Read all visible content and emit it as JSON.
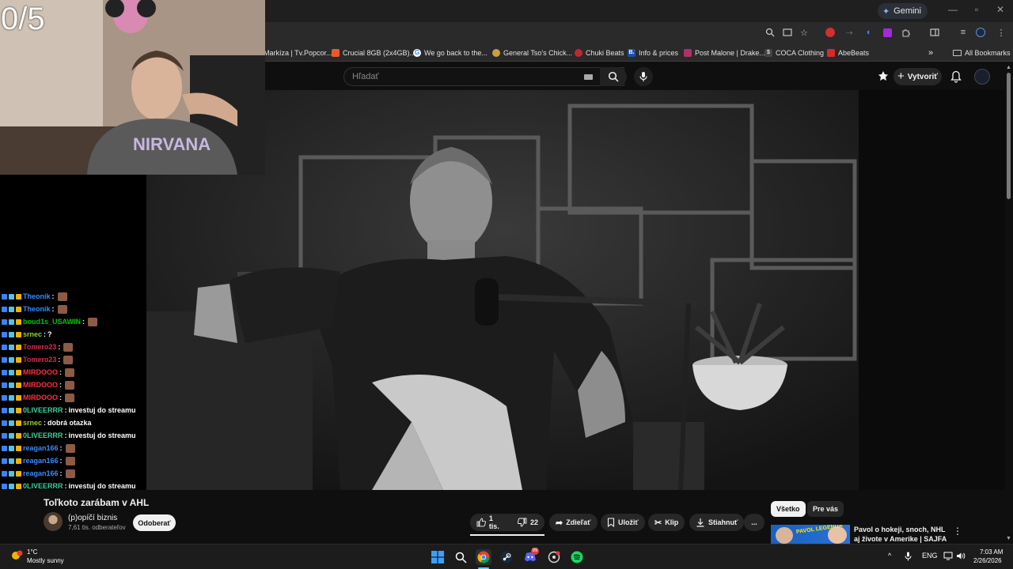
{
  "browser": {
    "gemini_label": "Gemini",
    "bookmarks": [
      {
        "label": "Markíza | Tv.Popcor...",
        "color": "#e8a000"
      },
      {
        "label": "Crucial 8GB (2x4GB)...",
        "color": "#e8592c"
      },
      {
        "label": "We go back to the...",
        "color": "#4285f4"
      },
      {
        "label": "General Tso's Chick...",
        "color": "#c8a040"
      },
      {
        "label": "Chuki Beats",
        "color": "#c4262e"
      },
      {
        "label": "Info & prices",
        "color": "#1f4fa8"
      },
      {
        "label": "Post Malone | Drake...",
        "color": "#b0306a"
      },
      {
        "label": "COCA Clothing",
        "color": "#444444"
      },
      {
        "label": "AbeBeats",
        "color": "#d62b2b"
      }
    ],
    "bookmarks_overflow": "»",
    "all_bookmarks": "All Bookmarks"
  },
  "youtube": {
    "search_placeholder": "Hľadať",
    "create_label": "Vytvoriť",
    "video_title": "Toľkoto zarábam v AHL",
    "channel_name": "(p)opíčí biznis",
    "channel_subs": "7,61 tis. odberateľov",
    "subscribe_label": "Odoberať",
    "like_count": "1 tis.",
    "dislike_count": "22",
    "share_label": "Zdieľať",
    "save_label": "Uložiť",
    "clip_label": "Klip",
    "download_label": "Stiahnuť",
    "more_label": "...",
    "chips": [
      "Všetko",
      "Pre vás"
    ],
    "rec_title": "Pavol o hokeji, snoch, NHL aj živote v Amerike | SAJFA ŠOU",
    "rec_thumb_text": "PAVOL LEGENDA"
  },
  "stream": {
    "counter": "0/5",
    "chat": [
      {
        "user": "Theonik",
        "color": "#2f8dff",
        "text": ""
      },
      {
        "user": "Theonik",
        "color": "#2f8dff",
        "text": ""
      },
      {
        "user": "boud1s_USAWIN",
        "color": "#00c000",
        "text": ""
      },
      {
        "user": "srnec",
        "color": "#9acd32",
        "text": "?"
      },
      {
        "user": "Tomero23",
        "color": "#d62b4a",
        "text": ""
      },
      {
        "user": "Tomero23",
        "color": "#d62b4a",
        "text": ""
      },
      {
        "user": "MIRDOOO",
        "color": "#ff3040",
        "text": ""
      },
      {
        "user": "MIRDOOO",
        "color": "#ff3040",
        "text": ""
      },
      {
        "user": "MIRDOOO",
        "color": "#ff3040",
        "text": ""
      },
      {
        "user": "0LIVEERRR",
        "color": "#3ccf9f",
        "text": "investuj do streamu"
      },
      {
        "user": "srnec",
        "color": "#9acd32",
        "text": "dobrá otazka"
      },
      {
        "user": "0LIVEERRR",
        "color": "#3ccf9f",
        "text": "investuj do streamu"
      },
      {
        "user": "reagan166",
        "color": "#3b8bff",
        "text": ""
      },
      {
        "user": "reagan166",
        "color": "#3b8bff",
        "text": ""
      },
      {
        "user": "reagan166",
        "color": "#3b8bff",
        "text": ""
      },
      {
        "user": "0LIVEERRR",
        "color": "#3ccf9f",
        "text": "investuj do streamu"
      }
    ]
  },
  "taskbar": {
    "weather_temp": "1°C",
    "weather_desc": "Mostly sunny",
    "lang": "ENG",
    "time": "7:03 AM",
    "date": "2/26/2026",
    "discord_badge": "99"
  }
}
